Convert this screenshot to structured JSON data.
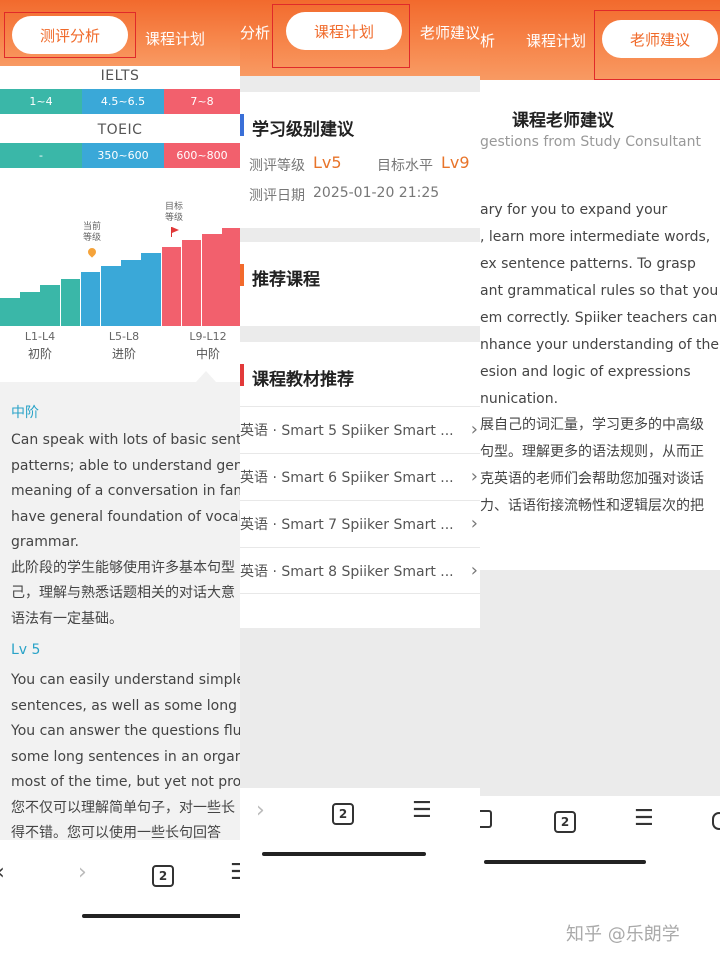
{
  "panel1": {
    "tabs": {
      "active": "测评分析",
      "next": "课程计划"
    },
    "ielts": {
      "title": "IELTS",
      "bands": [
        "1~4",
        "4.5~6.5",
        "7~8"
      ]
    },
    "toeic": {
      "title": "TOEIC",
      "bands": [
        "-",
        "350~600",
        "600~800"
      ]
    },
    "markers": {
      "current": "当前\n等级",
      "target": "目标\n等级"
    },
    "levels": [
      {
        "range": "L1-L4",
        "label": "初阶"
      },
      {
        "range": "L5-L8",
        "label": "进阶"
      },
      {
        "range": "L9-L12",
        "label": "中阶"
      }
    ],
    "description": {
      "heading1": "中阶",
      "lines1": [
        "Can speak with lots of basic sente",
        "patterns; able to understand gene",
        "meaning of a conversation in fam",
        "have general foundation of vocab",
        "grammar.",
        "此阶段的学生能够使用许多基本句型",
        "己，理解与熟悉话题相关的对话大意",
        "语法有一定基础。"
      ],
      "heading2": "Lv 5",
      "lines2": [
        "You can easily understand simple",
        "sentences, as well as some long s",
        "You can answer the questions flue",
        "some long sentences in an organ",
        "most of the time, but yet not prof",
        "您不仅可以理解简单句子，对一些长",
        "得不错。您可以使用一些长句回答"
      ]
    },
    "bottom_tab_count": "2"
  },
  "panel2": {
    "tabs": {
      "prev": "分析",
      "active": "课程计划",
      "next": "老师建议"
    },
    "level_section": {
      "title": "学习级别建议",
      "current_label": "测评等级",
      "current_value": "Lv5",
      "target_label": "目标水平",
      "target_value": "Lv9",
      "date_label": "测评日期",
      "date_value": "2025-01-20 21:25"
    },
    "course_section": {
      "title": "推荐课程"
    },
    "books_section": {
      "title": "课程教材推荐",
      "items": [
        "英语 · Smart 5 Spiiker Smart ...",
        "英语 · Smart 6 Spiiker Smart ...",
        "英语 · Smart 7 Spiiker Smart ...",
        "英语 · Smart 8 Spiiker Smart ..."
      ]
    },
    "bottom_tab_count": "2"
  },
  "panel3": {
    "tabs": {
      "prev": "析",
      "mid": "课程计划",
      "active": "老师建议"
    },
    "title": "课程老师建议",
    "subtitle": "gestions from Study Consultant",
    "body_lines": [
      "ary for you to expand your",
      ", learn more intermediate words,",
      "ex sentence patterns. To grasp",
      "ant grammatical rules so that you",
      "em correctly. Spiiker teachers can",
      "nhance your understanding of the",
      "esion and logic of expressions",
      "nunication.",
      "展自己的词汇量，学习更多的中高级",
      "句型。理解更多的语法规则，从而正",
      "克英语的老师们会帮助您加强对谈话",
      "力、话语衔接流畅性和逻辑层次的把"
    ],
    "bottom_tab_count": "2"
  },
  "watermark": "知乎 @乐朗学",
  "colors": {
    "header_orange": "#f26a2d",
    "teal": "#3ab7a8",
    "blue": "#3aa8d8",
    "pink": "#f2606d",
    "level_orange": "#e8742a",
    "highlight_red": "#e02a2a"
  }
}
